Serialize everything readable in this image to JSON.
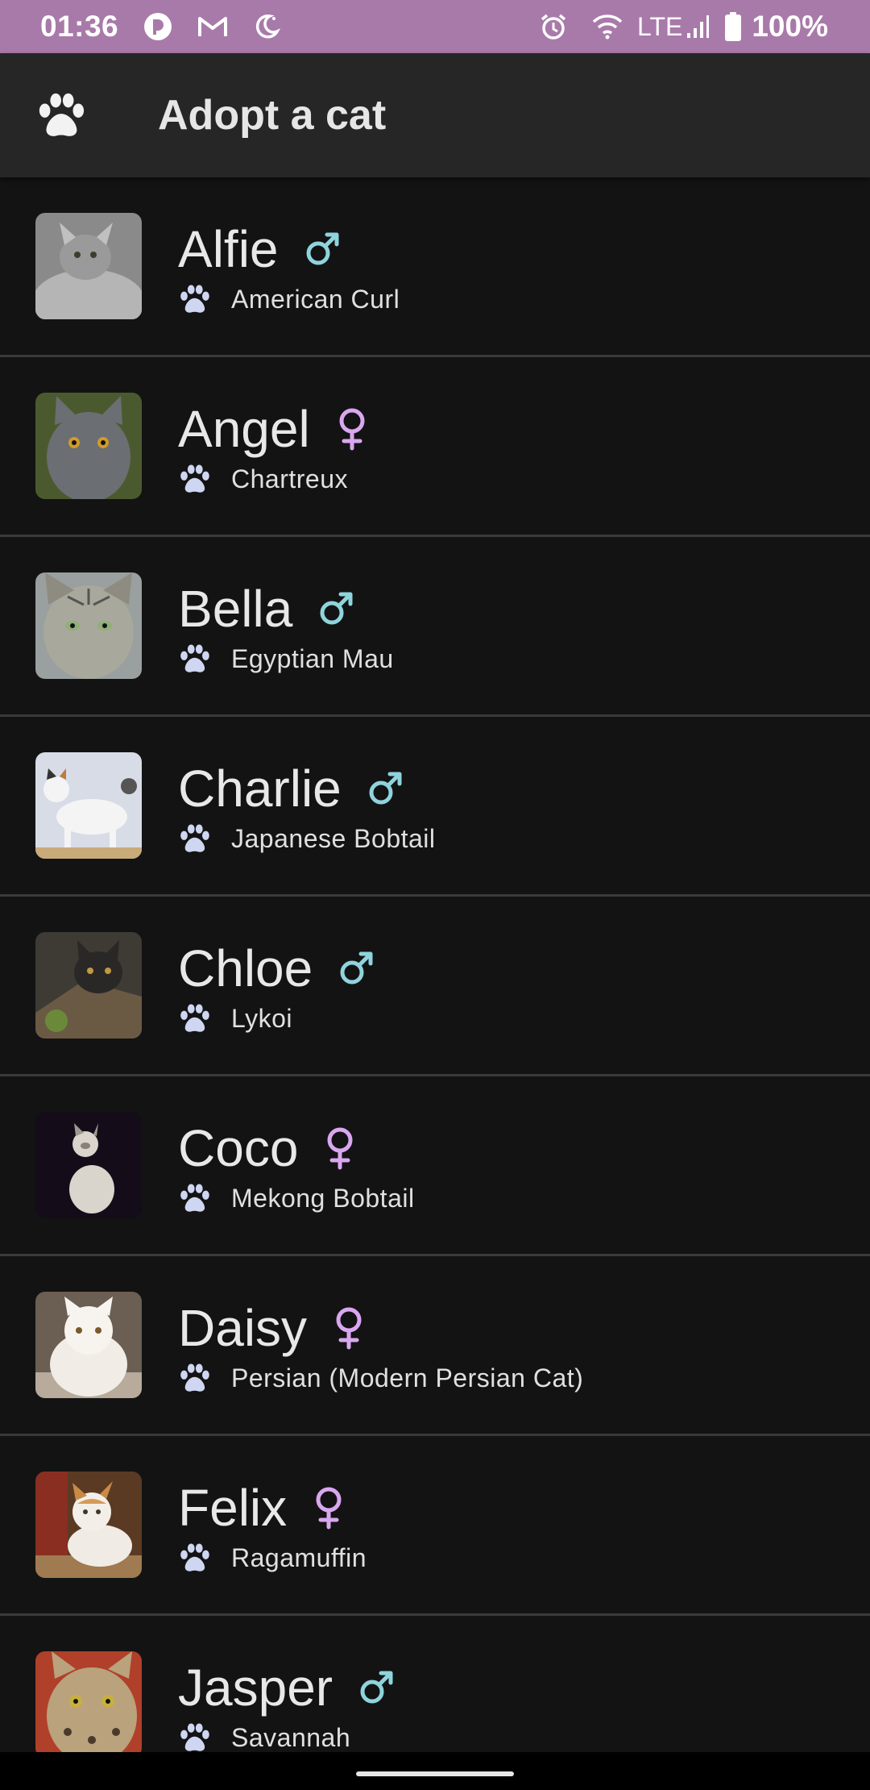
{
  "status_bar": {
    "time": "01:36",
    "network": "LTE",
    "battery": "100%"
  },
  "app_bar": {
    "title": "Adopt a cat",
    "icon": "paw-icon"
  },
  "colors": {
    "male": "#8fd4dc",
    "female": "#d9a7f0",
    "paw": "#cfd6f2",
    "status_bar_bg": "#a87aa9"
  },
  "cats": [
    {
      "name": "Alfie",
      "gender": "male",
      "breed": "American Curl"
    },
    {
      "name": "Angel",
      "gender": "female",
      "breed": "Chartreux"
    },
    {
      "name": "Bella",
      "gender": "male",
      "breed": "Egyptian Mau"
    },
    {
      "name": "Charlie",
      "gender": "male",
      "breed": "Japanese Bobtail"
    },
    {
      "name": "Chloe",
      "gender": "male",
      "breed": "Lykoi"
    },
    {
      "name": "Coco",
      "gender": "female",
      "breed": "Mekong Bobtail"
    },
    {
      "name": "Daisy",
      "gender": "female",
      "breed": "Persian (Modern Persian Cat)"
    },
    {
      "name": "Felix",
      "gender": "female",
      "breed": "Ragamuffin"
    },
    {
      "name": "Jasper",
      "gender": "male",
      "breed": "Savannah"
    }
  ]
}
